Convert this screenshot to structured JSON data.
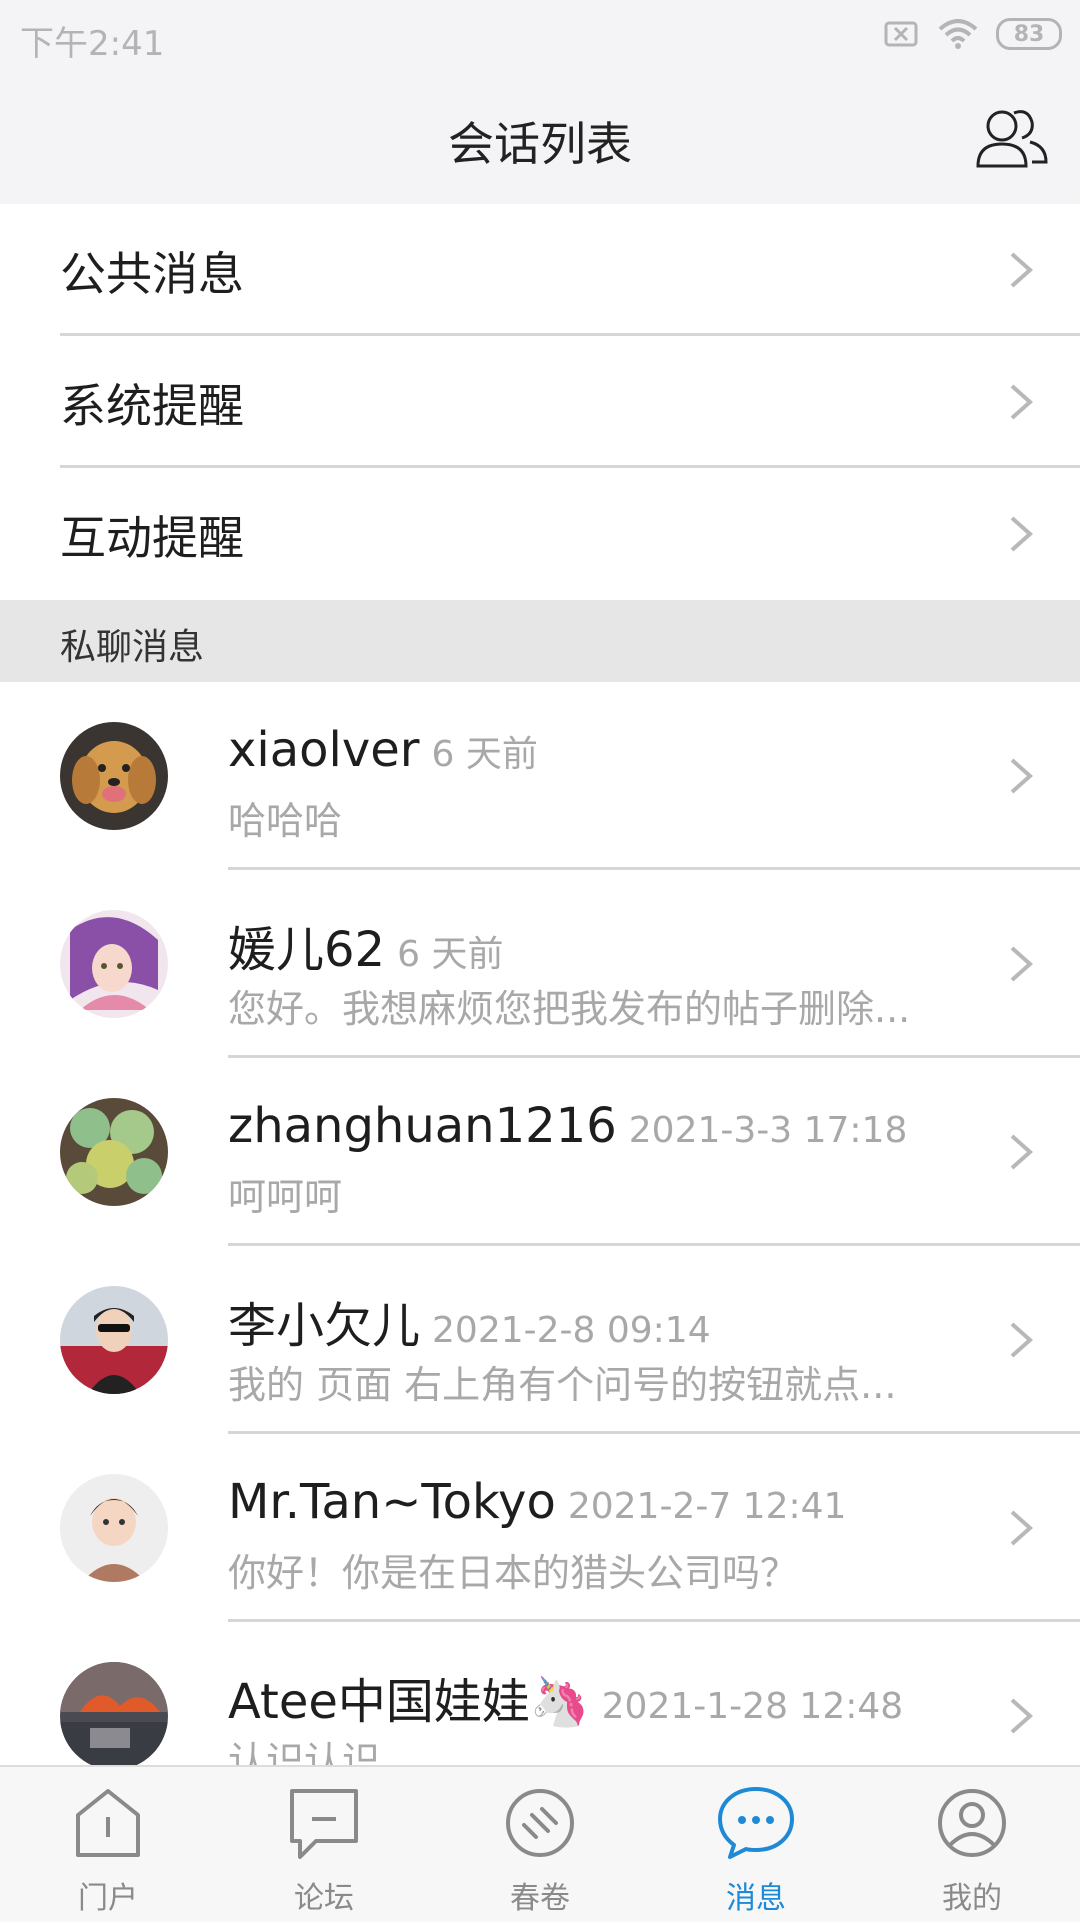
{
  "status_bar": {
    "time": "下午2:41",
    "battery": "83"
  },
  "header": {
    "title": "会话列表"
  },
  "menu": {
    "items": [
      {
        "label": "公共消息"
      },
      {
        "label": "系统提醒"
      },
      {
        "label": "互动提醒"
      }
    ]
  },
  "section": {
    "label": "私聊消息"
  },
  "chats": [
    {
      "name": "xiaolver",
      "time": "6 天前",
      "preview": "哈哈哈"
    },
    {
      "name": "媛儿62",
      "time": "6 天前",
      "preview": "您好。我想麻烦您把我发布的帖子删除..."
    },
    {
      "name": "zhanghuan1216",
      "time": "2021-3-3 17:18",
      "preview": "呵呵呵"
    },
    {
      "name": "李小欠儿",
      "time": "2021-2-8 09:14",
      "preview": "我的 页面 右上角有个问号的按钮就点..."
    },
    {
      "name": "Mr.Tan~Tokyo",
      "time": "2021-2-7 12:41",
      "preview": "你好！你是在日本的猎头公司吗？"
    },
    {
      "name": "Atee中国娃娃🦄",
      "time": "2021-1-28 12:48",
      "preview": "认识认识"
    }
  ],
  "tabbar": {
    "items": [
      {
        "label": "门户",
        "icon": "portal-icon"
      },
      {
        "label": "论坛",
        "icon": "forum-icon"
      },
      {
        "label": "春卷",
        "icon": "chunjuan-icon"
      },
      {
        "label": "消息",
        "icon": "message-icon",
        "active": true
      },
      {
        "label": "我的",
        "icon": "profile-icon"
      }
    ]
  },
  "colors": {
    "accent": "#1e8ad6",
    "muted": "#a8a8a8",
    "section_bg": "#e6e6e6"
  }
}
